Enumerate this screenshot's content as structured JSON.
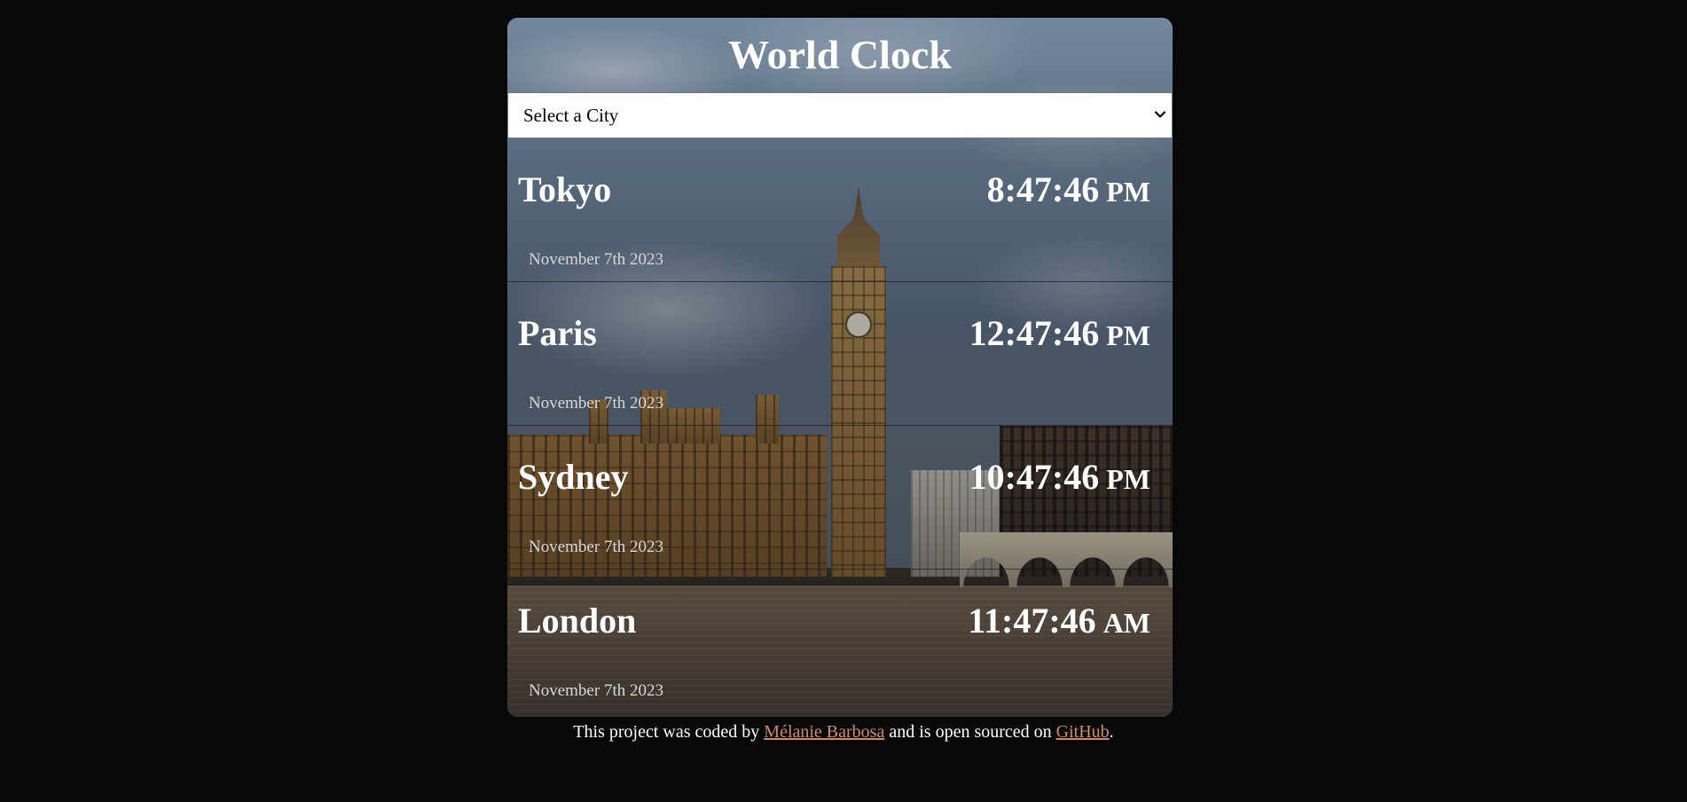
{
  "app": {
    "title": "World Clock"
  },
  "city_select": {
    "selected_label": "Select a City"
  },
  "cities": [
    {
      "name": "Tokyo",
      "time": "8:47:46",
      "ampm": "PM",
      "date": "November 7th 2023"
    },
    {
      "name": "Paris",
      "time": "12:47:46",
      "ampm": "PM",
      "date": "November 7th 2023"
    },
    {
      "name": "Sydney",
      "time": "10:47:46",
      "ampm": "PM",
      "date": "November 7th 2023"
    },
    {
      "name": "London",
      "time": "11:47:46",
      "ampm": "AM",
      "date": "November 7th 2023"
    }
  ],
  "footer": {
    "text_before": "This project was coded by ",
    "author_link": "Mélanie Barbosa",
    "text_middle": " and is open sourced on ",
    "repo_link": "GitHub",
    "text_after": "."
  },
  "colors": {
    "page_background": "#080808",
    "link": "#d28b6a",
    "text": "#ffffff"
  },
  "icons": {
    "select_chevron": "chevron-down-icon"
  }
}
